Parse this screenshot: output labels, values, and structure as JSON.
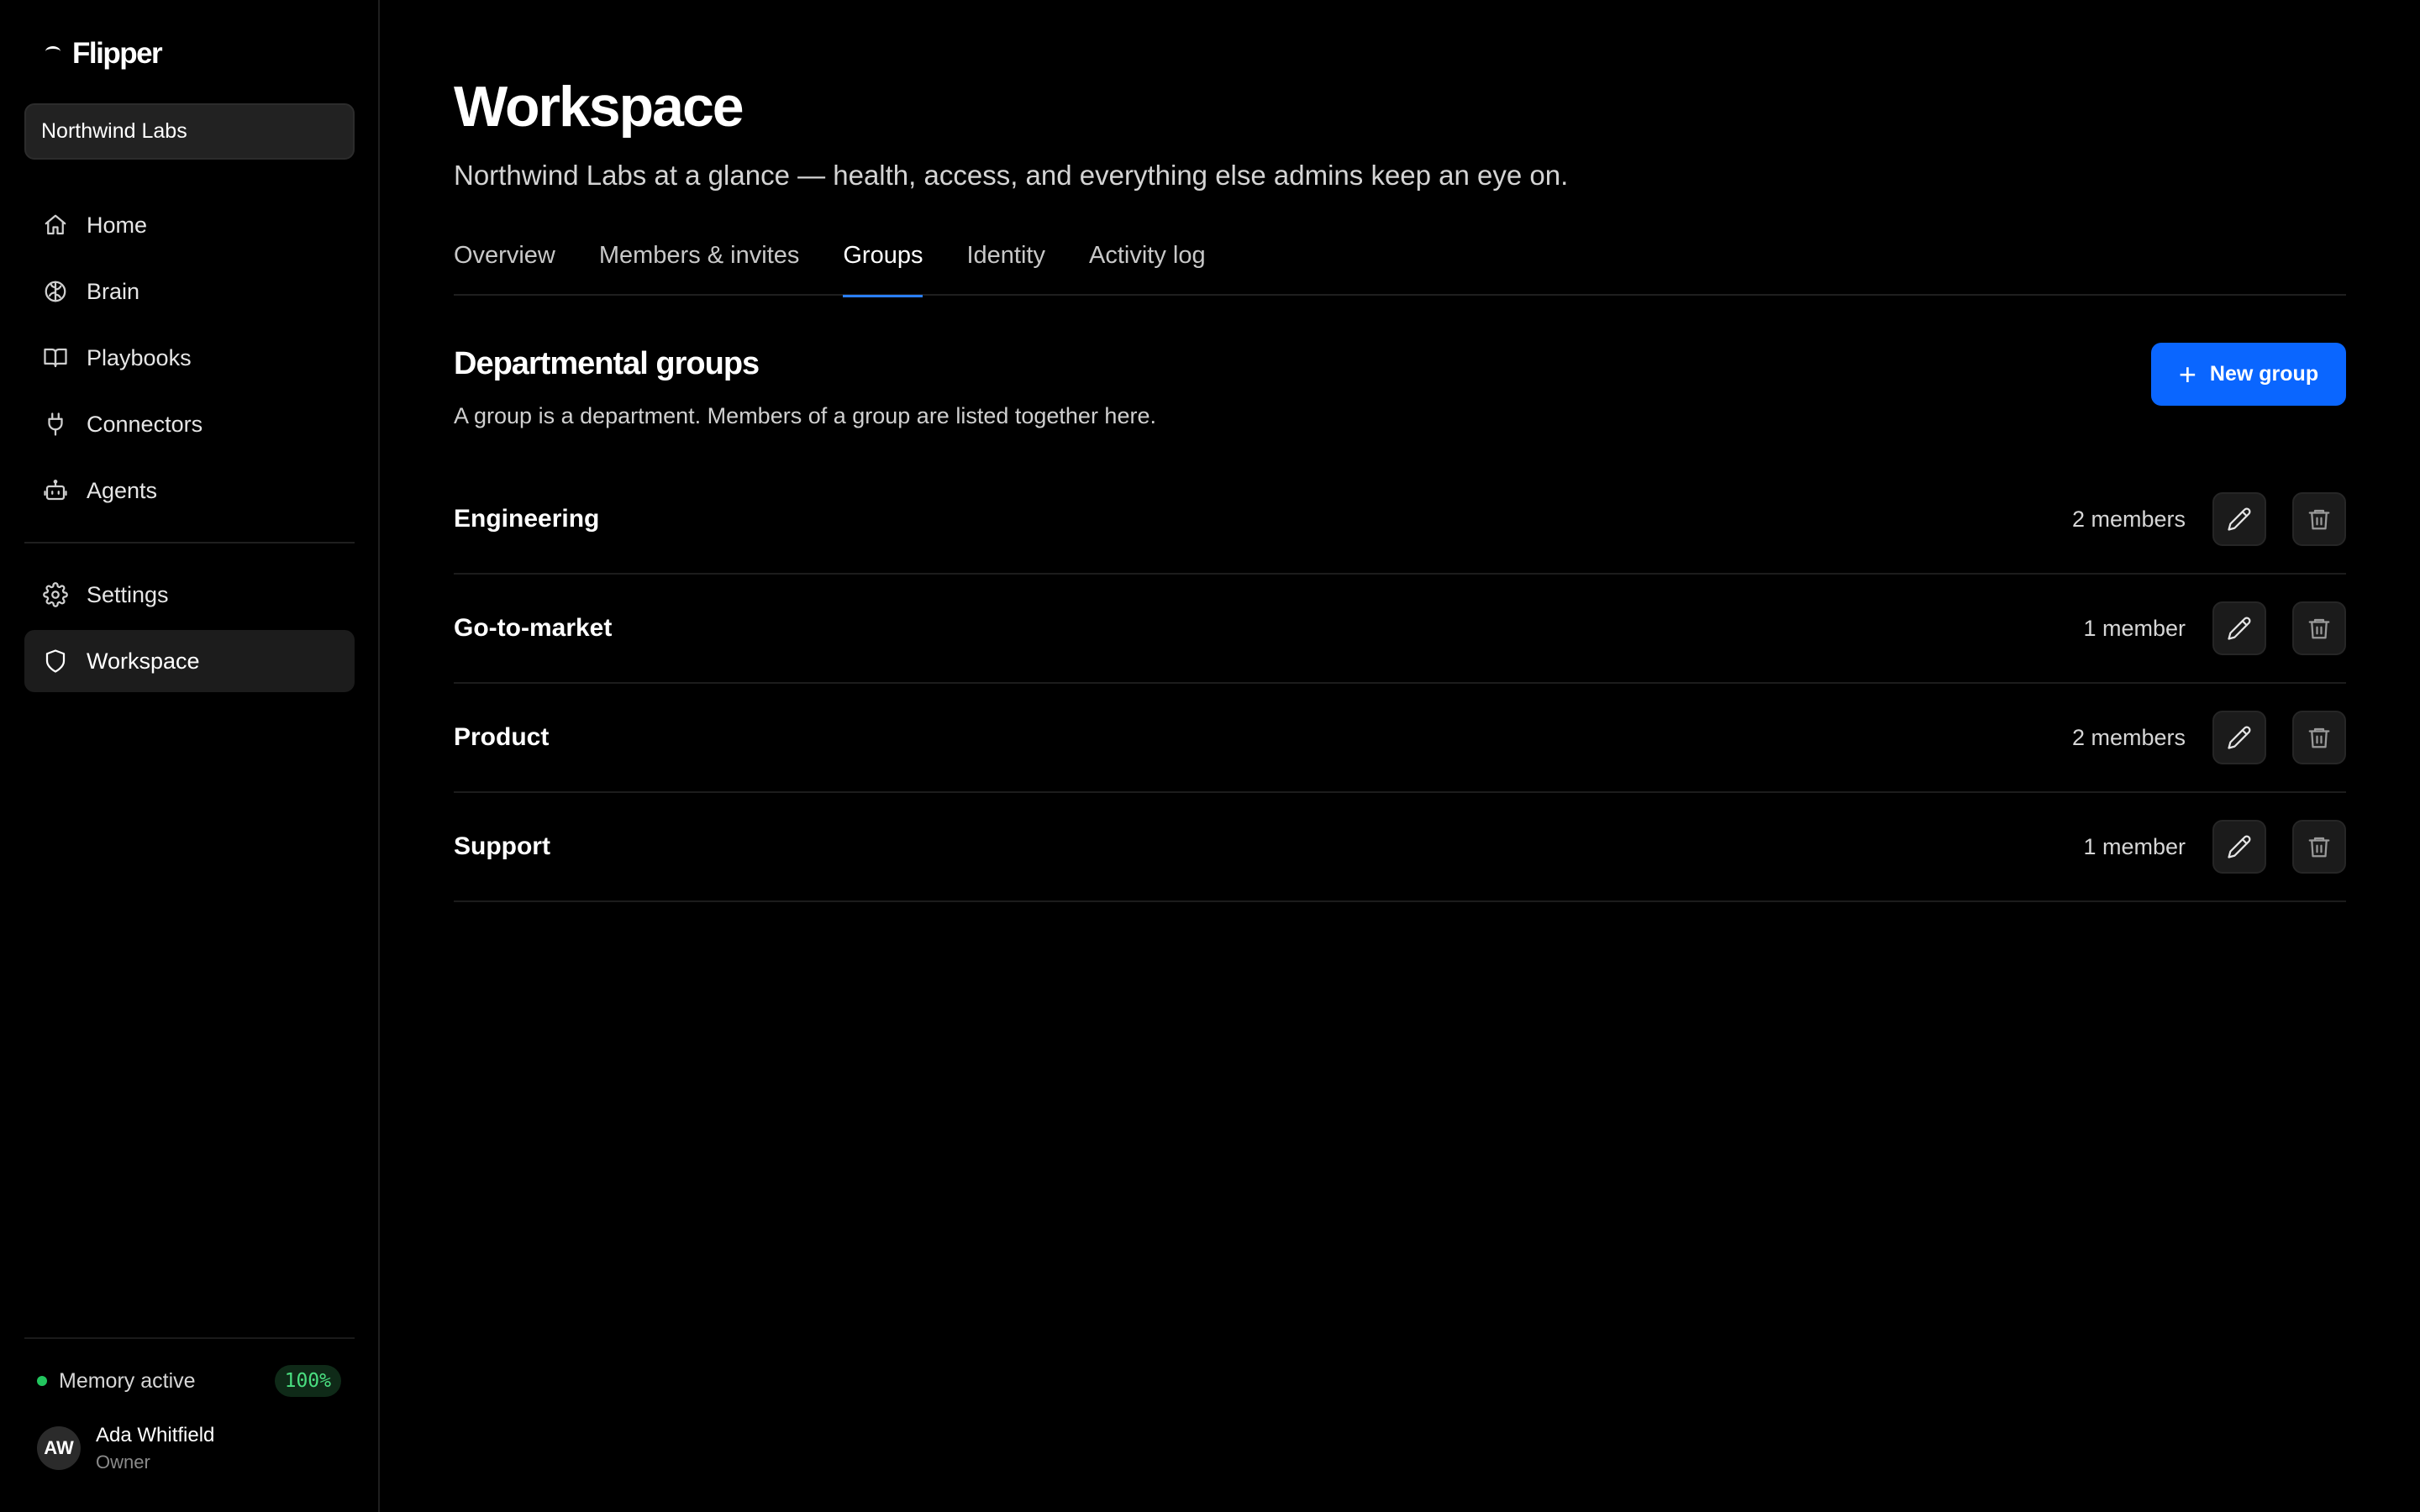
{
  "app": {
    "brand": "Flipper",
    "org": "Northwind Labs"
  },
  "sidebar": {
    "nav_top": [
      {
        "label": "Home",
        "icon": "home-icon"
      },
      {
        "label": "Brain",
        "icon": "brain-icon"
      },
      {
        "label": "Playbooks",
        "icon": "book-icon"
      },
      {
        "label": "Connectors",
        "icon": "plug-icon"
      },
      {
        "label": "Agents",
        "icon": "robot-icon"
      }
    ],
    "nav_bottom": [
      {
        "label": "Settings",
        "icon": "gear-icon"
      },
      {
        "label": "Workspace",
        "icon": "shield-icon",
        "active": true
      }
    ],
    "memory": {
      "label": "Memory active",
      "value": "100%",
      "status_color": "#22c55e"
    },
    "user": {
      "initials": "AW",
      "name": "Ada Whitfield",
      "role": "Owner"
    }
  },
  "main": {
    "title": "Workspace",
    "subtitle": "Northwind Labs at a glance — health, access, and everything else admins keep an eye on.",
    "tabs": [
      {
        "label": "Overview"
      },
      {
        "label": "Members & invites"
      },
      {
        "label": "Groups",
        "active": true
      },
      {
        "label": "Identity"
      },
      {
        "label": "Activity log"
      }
    ],
    "section": {
      "title": "Departmental groups",
      "description": "A group is a department. Members of a group are listed together here.",
      "new_button": "New group"
    },
    "groups": [
      {
        "name": "Engineering",
        "count": "2 members"
      },
      {
        "name": "Go-to-market",
        "count": "1 member"
      },
      {
        "name": "Product",
        "count": "2 members"
      },
      {
        "name": "Support",
        "count": "1 member"
      }
    ]
  },
  "colors": {
    "accent": "#0a66ff",
    "tab_underline": "#2a7fff",
    "background": "#000000"
  }
}
